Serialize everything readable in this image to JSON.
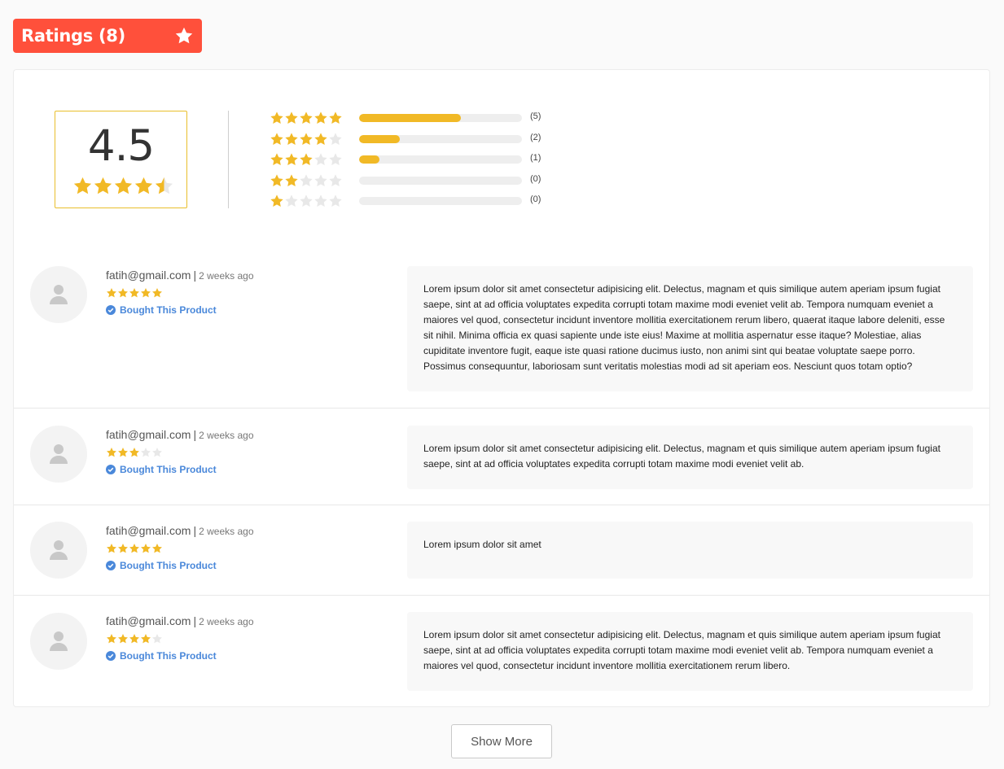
{
  "header": {
    "title": "Ratings (8)",
    "icon": "star-icon"
  },
  "summary": {
    "average": "4.5",
    "average_value": 4.5
  },
  "distribution": [
    {
      "stars": 5,
      "count_label": "(5)",
      "fraction": 0.625
    },
    {
      "stars": 4,
      "count_label": "(2)",
      "fraction": 0.25
    },
    {
      "stars": 3,
      "count_label": "(1)",
      "fraction": 0.125
    },
    {
      "stars": 2,
      "count_label": "(0)",
      "fraction": 0
    },
    {
      "stars": 1,
      "count_label": "(0)",
      "fraction": 0
    }
  ],
  "reviews": [
    {
      "email": "fatih@gmail.com",
      "separator": "|",
      "time": "2 weeks ago",
      "rating": 5,
      "bought_label": "Bought This Product",
      "comment": "Lorem ipsum dolor sit amet consectetur adipisicing elit. Delectus, magnam et quis similique autem aperiam ipsum fugiat saepe, sint at ad officia voluptates expedita corrupti totam maxime modi eveniet velit ab. Tempora numquam eveniet a maiores vel quod, consectetur incidunt inventore mollitia exercitationem rerum libero, quaerat itaque labore deleniti, esse sit nihil. Minima officia ex quasi sapiente unde iste eius! Maxime at mollitia aspernatur esse itaque? Molestiae, alias cupiditate inventore fugit, eaque iste quasi ratione ducimus iusto, non animi sint qui beatae voluptate saepe porro. Possimus consequuntur, laboriosam sunt veritatis molestias modi ad sit aperiam eos. Nesciunt quos totam optio?"
    },
    {
      "email": "fatih@gmail.com",
      "separator": "|",
      "time": "2 weeks ago",
      "rating": 3,
      "bought_label": "Bought This Product",
      "comment": "Lorem ipsum dolor sit amet consectetur adipisicing elit. Delectus, magnam et quis similique autem aperiam ipsum fugiat saepe, sint at ad officia voluptates expedita corrupti totam maxime modi eveniet velit ab."
    },
    {
      "email": "fatih@gmail.com",
      "separator": "|",
      "time": "2 weeks ago",
      "rating": 5,
      "bought_label": "Bought This Product",
      "comment": "Lorem ipsum dolor sit amet"
    },
    {
      "email": "fatih@gmail.com",
      "separator": "|",
      "time": "2 weeks ago",
      "rating": 4,
      "bought_label": "Bought This Product",
      "comment": "Lorem ipsum dolor sit amet consectetur adipisicing elit. Delectus, magnam et quis similique autem aperiam ipsum fugiat saepe, sint at ad officia voluptates expedita corrupti totam maxime modi eveniet velit ab. Tempora numquam eveniet a maiores vel quod, consectetur incidunt inventore mollitia exercitationem rerum libero."
    }
  ],
  "show_more_label": "Show More",
  "colors": {
    "accent": "#ff503b",
    "star": "#f1b926",
    "star_empty": "#e8e8e8",
    "verified": "#4a88da"
  }
}
